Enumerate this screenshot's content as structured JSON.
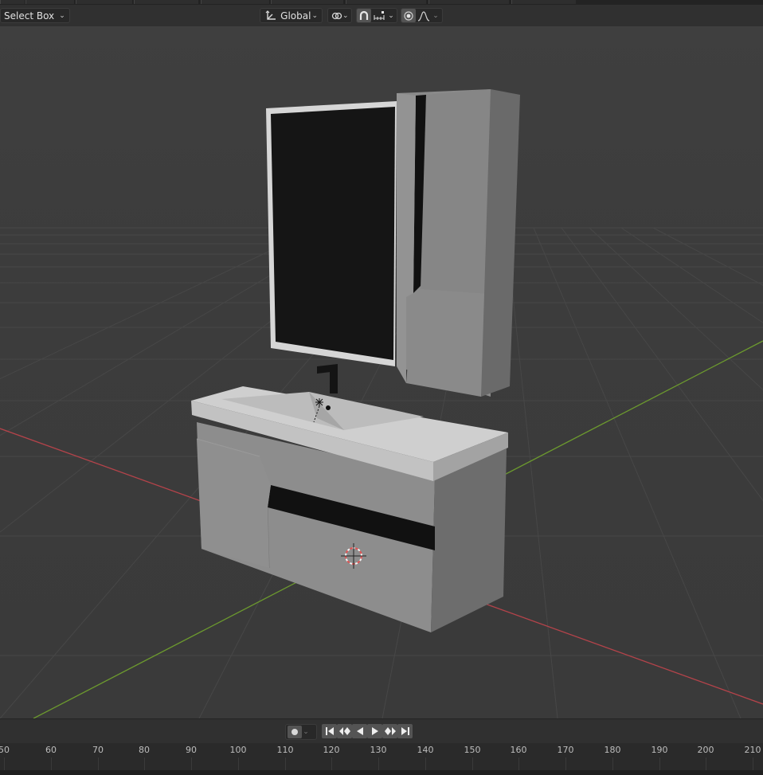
{
  "header": {
    "select_mode": "Select Box",
    "transform_orientation": "Global",
    "icons": [
      "transform-orientation-icon",
      "pivot-point-icon",
      "snap-icon",
      "snap-increment-icon",
      "proportional-editing-icon",
      "falloff-curve-icon"
    ]
  },
  "timeline": {
    "record_icon": "record-icon",
    "buttons": [
      "jump-to-start-icon",
      "jump-to-previous-keyframe-icon",
      "play-reverse-icon",
      "play-icon",
      "jump-to-next-keyframe-icon",
      "jump-to-end-icon"
    ],
    "frames": [
      "50",
      "60",
      "70",
      "80",
      "90",
      "100",
      "110",
      "120",
      "130",
      "140",
      "150",
      "160",
      "170",
      "180",
      "190",
      "200",
      "210"
    ]
  },
  "colors": {
    "x_axis": "#b4434a",
    "y_axis": "#6c9a2e",
    "background": "#3d3d3d"
  }
}
